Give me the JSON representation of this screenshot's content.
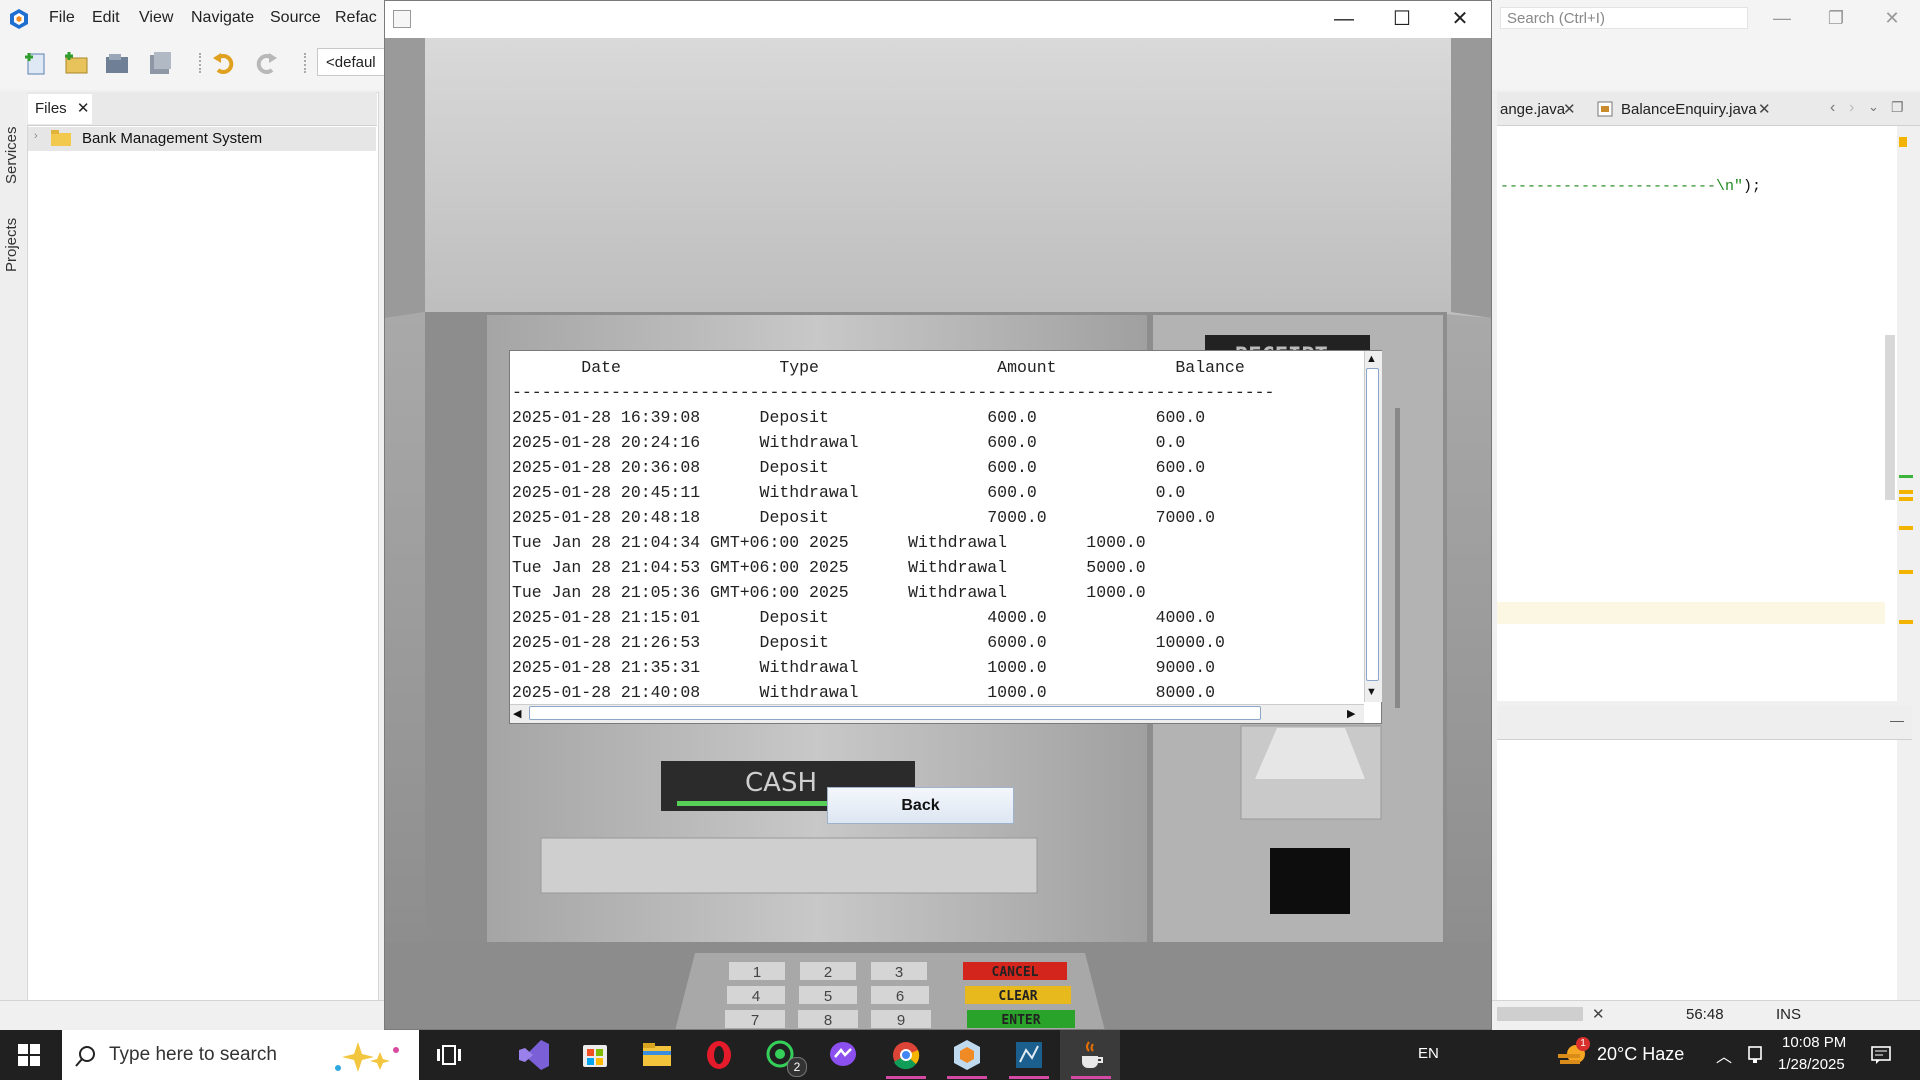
{
  "ide": {
    "menu": [
      "File",
      "Edit",
      "View",
      "Navigate",
      "Source",
      "Refac"
    ],
    "search_placeholder": "Search (Ctrl+I)",
    "config_combo": "<defaul",
    "left_tabs": [
      "Services",
      "Projects"
    ],
    "files_tab": "Files",
    "tree_item": "Bank Management System",
    "editor_tabs": [
      "ange.java",
      "BalanceEnquiry.java"
    ],
    "code_line_dashes": "------------------------\\n\"",
    "code_line_end": ");",
    "status": {
      "position": "56:48",
      "mode": "INS"
    }
  },
  "window": {
    "title": "",
    "controls": {
      "minimize": "—",
      "maximize": "☐",
      "close": "✕"
    }
  },
  "atm": {
    "receipt_label": "RECEIPT",
    "cash_label": "CASH",
    "keypad": [
      "1",
      "2",
      "3",
      "4",
      "5",
      "6",
      "7",
      "8",
      "9"
    ],
    "function_keys": [
      {
        "label": "CANCEL",
        "color": "#d4251c"
      },
      {
        "label": "CLEAR",
        "color": "#e7b91c"
      },
      {
        "label": "ENTER",
        "color": "#2aa32a"
      }
    ]
  },
  "statement": {
    "header": "       Date                Type                  Amount            Balance",
    "separator": "-----------------------------------------------------------------------------",
    "rows": [
      "2025-01-28 16:39:08      Deposit                600.0            600.0",
      "2025-01-28 20:24:16      Withdrawal             600.0            0.0",
      "2025-01-28 20:36:08      Deposit                600.0            600.0",
      "2025-01-28 20:45:11      Withdrawal             600.0            0.0",
      "2025-01-28 20:48:18      Deposit                7000.0           7000.0",
      "Tue Jan 28 21:04:34 GMT+06:00 2025      Withdrawal        1000.0",
      "Tue Jan 28 21:04:53 GMT+06:00 2025      Withdrawal        5000.0",
      "Tue Jan 28 21:05:36 GMT+06:00 2025      Withdrawal        1000.0",
      "2025-01-28 21:15:01      Deposit                4000.0           4000.0",
      "2025-01-28 21:26:53      Deposit                6000.0           10000.0",
      "2025-01-28 21:35:31      Withdrawal             1000.0           9000.0",
      "2025-01-28 21:40:08      Withdrawal             1000.0           8000.0"
    ],
    "back_button": "Back"
  },
  "taskbar": {
    "search_placeholder": "Type here to search",
    "apps": [
      "task-view",
      "visual-studio",
      "microsoft-store",
      "file-explorer",
      "opera",
      "whatsapp",
      "messenger",
      "chrome",
      "netbeans",
      "mysql-workbench",
      "java"
    ],
    "whatsapp_badge": "2",
    "language": "EN",
    "weather": "20°C  Haze",
    "weather_badge": "1",
    "time": "10:08 PM",
    "date": "1/28/2025"
  }
}
